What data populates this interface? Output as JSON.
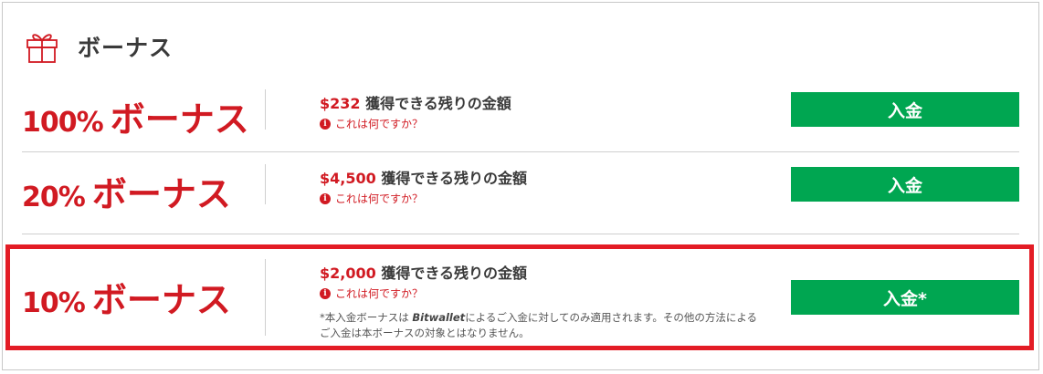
{
  "section": {
    "title": "ボーナス",
    "icon": "gift-icon"
  },
  "rows": [
    {
      "percent": "100%",
      "word": "ボーナス",
      "amount": "$232",
      "amount_suffix": " 獲得できる残りの金額",
      "help": "これは何ですか？",
      "button": "入金"
    },
    {
      "percent": "20%",
      "word": "ボーナス",
      "amount": "$4,500",
      "amount_suffix": " 獲得できる残りの金額",
      "help": "これは何ですか？",
      "button": "入金"
    },
    {
      "percent": "10%",
      "word": "ボーナス",
      "amount": "$2,000",
      "amount_suffix": " 獲得できる残りの金額",
      "help": "これは何ですか？",
      "button": "入金*",
      "note_prefix": "*本入金ボーナスは ",
      "note_brand": "Bitwallet",
      "note_suffix": "によるご入金に対してのみ適用されます。その他の方法によるご入金は本ボーナスの対象とはなりません。"
    }
  ],
  "colors": {
    "accent_red": "#d11a22",
    "button_green": "#00a651",
    "highlight_border": "#e31c25"
  }
}
